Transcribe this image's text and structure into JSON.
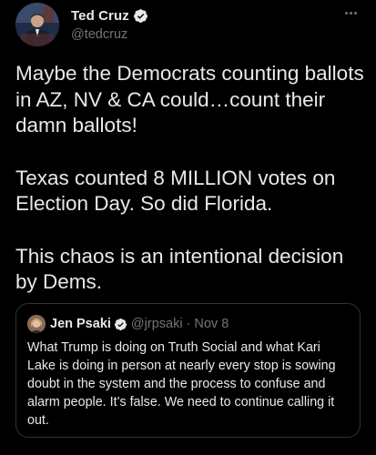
{
  "tweet": {
    "author": {
      "display_name": "Ted Cruz",
      "handle": "@tedcruz",
      "verified": true
    },
    "paragraphs": [
      "Maybe the Democrats counting ballots in AZ, NV & CA could…count their damn ballots!",
      "Texas counted 8 MILLION votes on Election Day. So did Florida.",
      "This chaos is an intentional decision by Dems."
    ],
    "more_icon": "more-horizontal-icon"
  },
  "quoted_tweet": {
    "author": {
      "display_name": "Jen Psaki",
      "handle": "@jrpsaki",
      "verified": true
    },
    "separator": "·",
    "date": "Nov 8",
    "text": "What Trump is doing on Truth Social and what Kari Lake is doing in person at nearly every stop is sowing doubt in the system and the process to confuse and alarm people.  It’s false.  We need to continue calling it out."
  },
  "colors": {
    "background": "#000000",
    "primary_text": "#e7e9ea",
    "secondary_text": "#71767b",
    "border": "#2f3336",
    "verified_badge": "#1d9bf0"
  }
}
